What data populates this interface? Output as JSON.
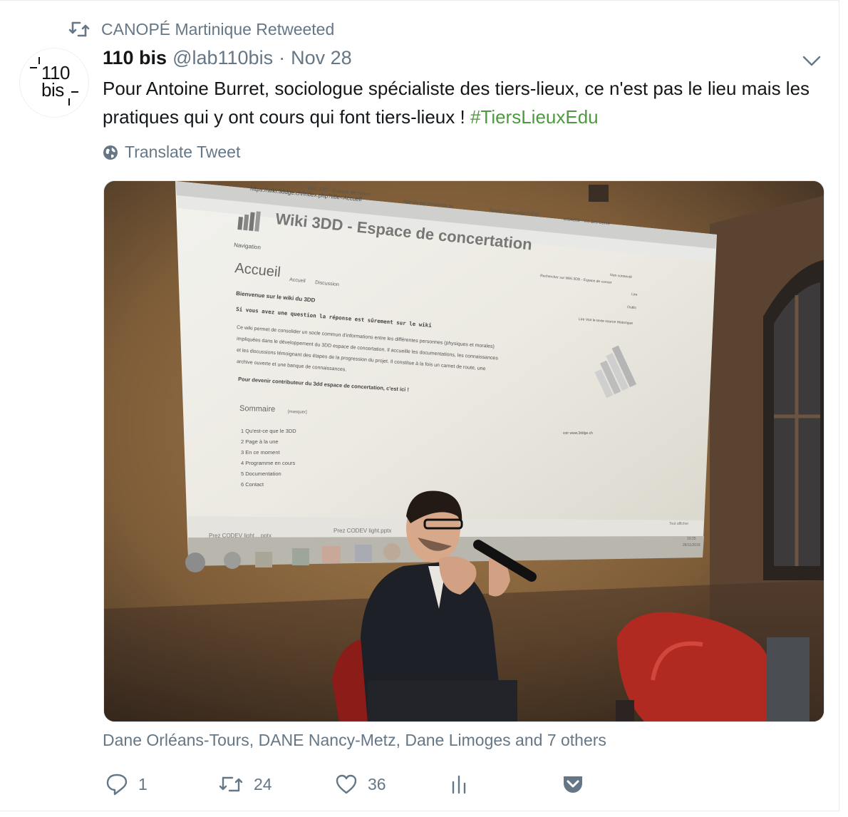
{
  "retweet_context": {
    "text": "CANOPÉ Martinique Retweeted"
  },
  "tweet": {
    "author_name": "110 bis",
    "author_handle": "@lab110bis",
    "separator": "·",
    "date": "Nov 28",
    "text": "Pour Antoine Burret, sociologue spécialiste des tiers-lieux, ce n'est pas le lieu mais les pratiques qui y ont cours qui font tiers-lieux ! ",
    "hashtag": "#TiersLieuxEdu",
    "translate_label": "Translate Tweet",
    "tagged": "Dane Orléans-Tours, DANE Nancy-Metz, Dane Limoges and 7 others",
    "avatar_logo": {
      "line1": "110",
      "line2": "bis"
    }
  },
  "photo_screen": {
    "tab1": "Wiki 3DD - Espace de conce",
    "tab2": "Agenda des rencontres au",
    "tab3": "Ajouter Réservation | 3DD",
    "tab4": "ECAGSI - Vis des Conte",
    "url": "https://wiki.3ddge.ch/index.php?title=Accueil",
    "site_title": "Wiki 3DD - Espace de concertation",
    "navigation": "Navigation",
    "page_heading": "Accueil",
    "tab_accueil": "Accueil",
    "tab_discussion": "Discussion",
    "status": "Non connecté",
    "search": "Rechercher sur Wiki 3DD - Espace de concer",
    "read_tabs": "Lire  Voir le texte source  Historique",
    "tools": "Outils",
    "read": "Lire",
    "welcome": "Bienvenue sur le wiki du 3DD",
    "question": "Si vous avez une question la réponse est sûrement sur le wiki",
    "para1": "Ce wiki permet de consolider un socle commun d'informations entre les différentes personnes (physiques et morales)",
    "para2": "impliquées dans le développement du 3DD espace de concertation. Il accueille les documentations, les connaissances",
    "para3": "et les discussions témoignant des étapes de la progression du projet. Il constitue à la fois un carnet de route, une",
    "para4": "archive ouverte et une banque de connaissances.",
    "contribute": "Pour devenir contributeur du 3dd espace de concertation, c'est ici !",
    "toc_title": "Sommaire",
    "toc_hide": "[masquer]",
    "toc": [
      "1 Qu'est-ce que le 3DD",
      "2 Page à la une",
      "3 En ce moment",
      "4 Programme en cours",
      "5 Documentation",
      "6 Contact"
    ],
    "see_link": "voir www.3ddge.ch",
    "download1": "Prez CODEV light....pptx",
    "download2": "Prez CODEV light.pptx",
    "show_all": "Tout afficher",
    "clock_time": "10:25",
    "clock_date": "28/11/2018"
  },
  "actions": {
    "reply_count": "1",
    "retweet_count": "24",
    "like_count": "36"
  },
  "colors": {
    "secondary_text": "#657786",
    "hashtag": "#4e9a3f",
    "primary_text": "#14171a"
  }
}
